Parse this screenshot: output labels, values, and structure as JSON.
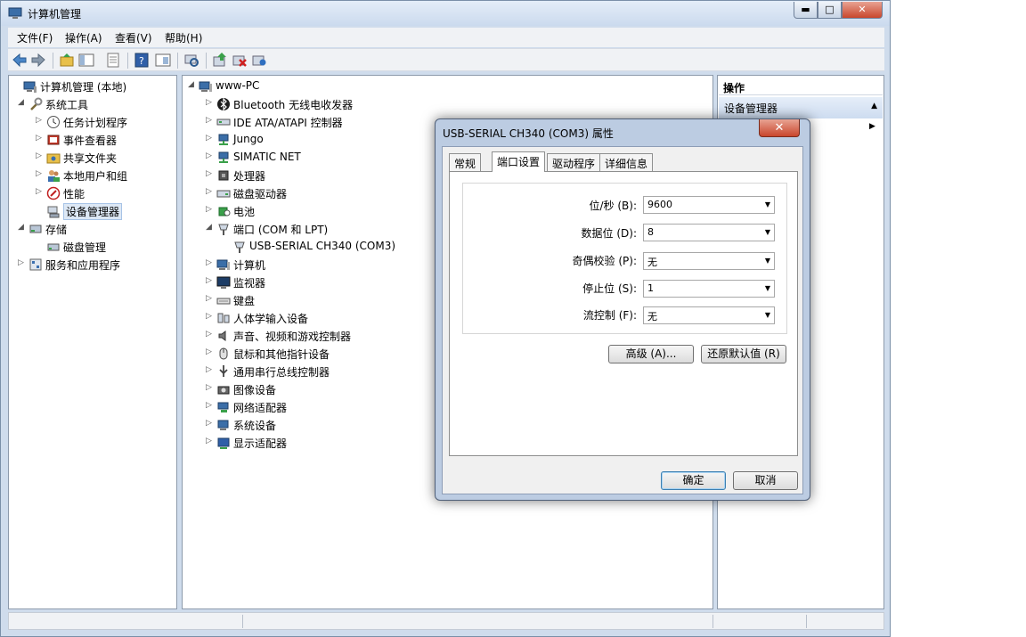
{
  "window": {
    "title": "计算机管理"
  },
  "window_buttons": {
    "minimize": "▬",
    "maximize": "□",
    "close": "✕"
  },
  "menu": [
    "文件(F)",
    "操作(A)",
    "查看(V)",
    "帮助(H)"
  ],
  "left_tree": [
    {
      "label": "计算机管理 (本地)",
      "icon": "computer-management-icon",
      "arrow": ""
    },
    {
      "label": "系统工具",
      "icon": "tools-icon",
      "arrow": "◢"
    },
    {
      "label": "任务计划程序",
      "icon": "clock-icon",
      "arrow": "▷"
    },
    {
      "label": "事件查看器",
      "icon": "event-viewer-icon",
      "arrow": "▷"
    },
    {
      "label": "共享文件夹",
      "icon": "shared-folder-icon",
      "arrow": "▷"
    },
    {
      "label": "本地用户和组",
      "icon": "users-icon",
      "arrow": "▷"
    },
    {
      "label": "性能",
      "icon": "performance-icon",
      "arrow": "▷"
    },
    {
      "label": "设备管理器",
      "icon": "device-manager-icon",
      "arrow": "",
      "selected": true
    },
    {
      "label": "存储",
      "icon": "storage-icon",
      "arrow": "◢"
    },
    {
      "label": "磁盘管理",
      "icon": "disk-management-icon",
      "arrow": ""
    },
    {
      "label": "服务和应用程序",
      "icon": "services-icon",
      "arrow": "▷"
    }
  ],
  "device_tree": [
    {
      "label": "www-PC",
      "icon": "computer-icon",
      "arrow": "◢"
    },
    {
      "label": "Bluetooth 无线电收发器",
      "icon": "bluetooth-icon",
      "arrow": "▷"
    },
    {
      "label": "IDE ATA/ATAPI 控制器",
      "icon": "ide-controller-icon",
      "arrow": "▷"
    },
    {
      "label": "Jungo",
      "icon": "network-device-icon",
      "arrow": "▷"
    },
    {
      "label": "SIMATIC NET",
      "icon": "network-device-icon",
      "arrow": "▷"
    },
    {
      "label": "处理器",
      "icon": "processor-icon",
      "arrow": "▷"
    },
    {
      "label": "磁盘驱动器",
      "icon": "disk-drive-icon",
      "arrow": "▷"
    },
    {
      "label": "电池",
      "icon": "battery-icon",
      "arrow": "▷"
    },
    {
      "label": "端口 (COM 和 LPT)",
      "icon": "port-icon",
      "arrow": "◢"
    },
    {
      "label": "USB-SERIAL CH340 (COM3)",
      "icon": "port-icon",
      "arrow": ""
    },
    {
      "label": "计算机",
      "icon": "computer-icon",
      "arrow": "▷"
    },
    {
      "label": "监视器",
      "icon": "monitor-icon",
      "arrow": "▷"
    },
    {
      "label": "键盘",
      "icon": "keyboard-icon",
      "arrow": "▷"
    },
    {
      "label": "人体学输入设备",
      "icon": "hid-icon",
      "arrow": "▷"
    },
    {
      "label": "声音、视频和游戏控制器",
      "icon": "speaker-icon",
      "arrow": "▷"
    },
    {
      "label": "鼠标和其他指针设备",
      "icon": "mouse-icon",
      "arrow": "▷"
    },
    {
      "label": "通用串行总线控制器",
      "icon": "usb-icon",
      "arrow": "▷"
    },
    {
      "label": "图像设备",
      "icon": "camera-icon",
      "arrow": "▷"
    },
    {
      "label": "网络适配器",
      "icon": "network-adapter-icon",
      "arrow": "▷"
    },
    {
      "label": "系统设备",
      "icon": "system-device-icon",
      "arrow": "▷"
    },
    {
      "label": "显示适配器",
      "icon": "display-adapter-icon",
      "arrow": "▷"
    }
  ],
  "actions": {
    "header": "操作",
    "item": "设备管理器",
    "up_arrow": "▲",
    "more_arrow": "▶"
  },
  "dialog": {
    "title": "USB-SERIAL CH340 (COM3) 属性",
    "close": "✕",
    "tabs": [
      "常规",
      "端口设置",
      "驱动程序",
      "详细信息"
    ],
    "active_tab": 1,
    "fields": [
      {
        "label": "位/秒 (B):",
        "value": "9600"
      },
      {
        "label": "数据位 (D):",
        "value": "8"
      },
      {
        "label": "奇偶校验 (P):",
        "value": "无"
      },
      {
        "label": "停止位 (S):",
        "value": "1"
      },
      {
        "label": "流控制 (F):",
        "value": "无"
      }
    ],
    "dropdown_glyph": "▼",
    "advanced_button": "高级 (A)...",
    "restore_button": "还原默认值 (R)",
    "ok_button": "确定",
    "cancel_button": "取消"
  },
  "colors": {
    "window_frame": "#cfdcec",
    "selection": "#dde8f5",
    "close_red": "#c9462c"
  }
}
